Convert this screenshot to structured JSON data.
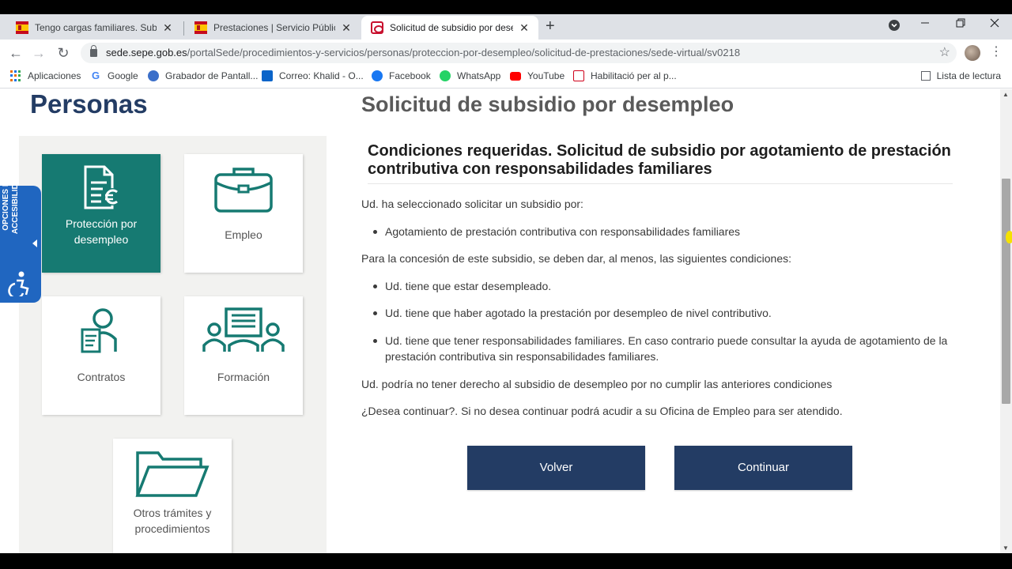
{
  "browser": {
    "tabs": [
      {
        "title": "Tengo cargas familiares. Subsidio",
        "favicon": "spain-flag-icon",
        "active": false
      },
      {
        "title": "Prestaciones | Servicio Público de",
        "favicon": "spain-flag-icon",
        "active": false
      },
      {
        "title": "Solicitud de subsidio por desemp",
        "favicon": "sepe-icon",
        "active": true
      }
    ],
    "new_tab": "+",
    "url_domain": "sede.sepe.gob.es",
    "url_path": "/portalSede/procedimientos-y-servicios/personas/proteccion-por-desempleo/solicitud-de-prestaciones/sede-virtual/sv0218",
    "bookmarks": [
      {
        "label": "Aplicaciones",
        "icon": "apps-grid-icon"
      },
      {
        "label": "Google",
        "icon": "google-icon",
        "color": "#4285f4"
      },
      {
        "label": "Grabador de Pantall...",
        "icon": "recorder-icon",
        "color": "#3b6fc9"
      },
      {
        "label": "Correo: Khalid - O...",
        "icon": "outlook-icon",
        "color": "#0a64c9"
      },
      {
        "label": "Facebook",
        "icon": "facebook-icon",
        "color": "#1877f2"
      },
      {
        "label": "WhatsApp",
        "icon": "whatsapp-icon",
        "color": "#25d366"
      },
      {
        "label": "YouTube",
        "icon": "youtube-icon",
        "color": "#ff0000"
      },
      {
        "label": "Habilitació per al p...",
        "icon": "gencat-icon",
        "color": "#d0021b"
      }
    ],
    "reading_list": "Lista de lectura"
  },
  "sidebar": {
    "title": "Personas",
    "accessibility_tab": "OPCIONES DE ACCESIBILIDAD",
    "cards": [
      {
        "label": "Protección por desempleo",
        "icon": "document-euro-icon",
        "active": true
      },
      {
        "label": "Empleo",
        "icon": "briefcase-icon",
        "active": false
      },
      {
        "label": "Contratos",
        "icon": "contract-person-icon",
        "active": false
      },
      {
        "label": "Formación",
        "icon": "training-icon",
        "active": false
      },
      {
        "label": "Otros trámites y procedimientos",
        "icon": "folder-icon",
        "active": false
      }
    ]
  },
  "main": {
    "title": "Solicitud de subsidio por desempleo",
    "subtitle": "Condiciones requeridas. Solicitud de subsidio por agotamiento de prestación contributiva con responsabilidades familiares",
    "intro": "Ud. ha seleccionado solicitar un subsidio por:",
    "selected_items": [
      "Agotamiento de prestación contributiva con responsabilidades familiares"
    ],
    "conditions_intro": "Para la concesión de este subsidio, se deben dar, al menos, las siguientes condiciones:",
    "conditions": [
      "Ud. tiene que estar desempleado.",
      "Ud. tiene que haber agotado la prestación por desempleo de nivel contributivo.",
      "Ud. tiene que tener responsabilidades familiares. En caso contrario puede consultar la ayuda de agotamiento de la prestación contributiva sin responsabilidades familiares."
    ],
    "warning": "Ud. podría no tener derecho al subsidio de desempleo por no cumplir las anteriores condiciones",
    "question": "¿Desea continuar?. Si no desea continuar podrá acudir a su Oficina de Empleo para ser atendido.",
    "back_label": "Volver",
    "continue_label": "Continuar"
  },
  "colors": {
    "primary_navy": "#233c64",
    "teal": "#167a72",
    "accessibility_blue": "#2066c0"
  }
}
